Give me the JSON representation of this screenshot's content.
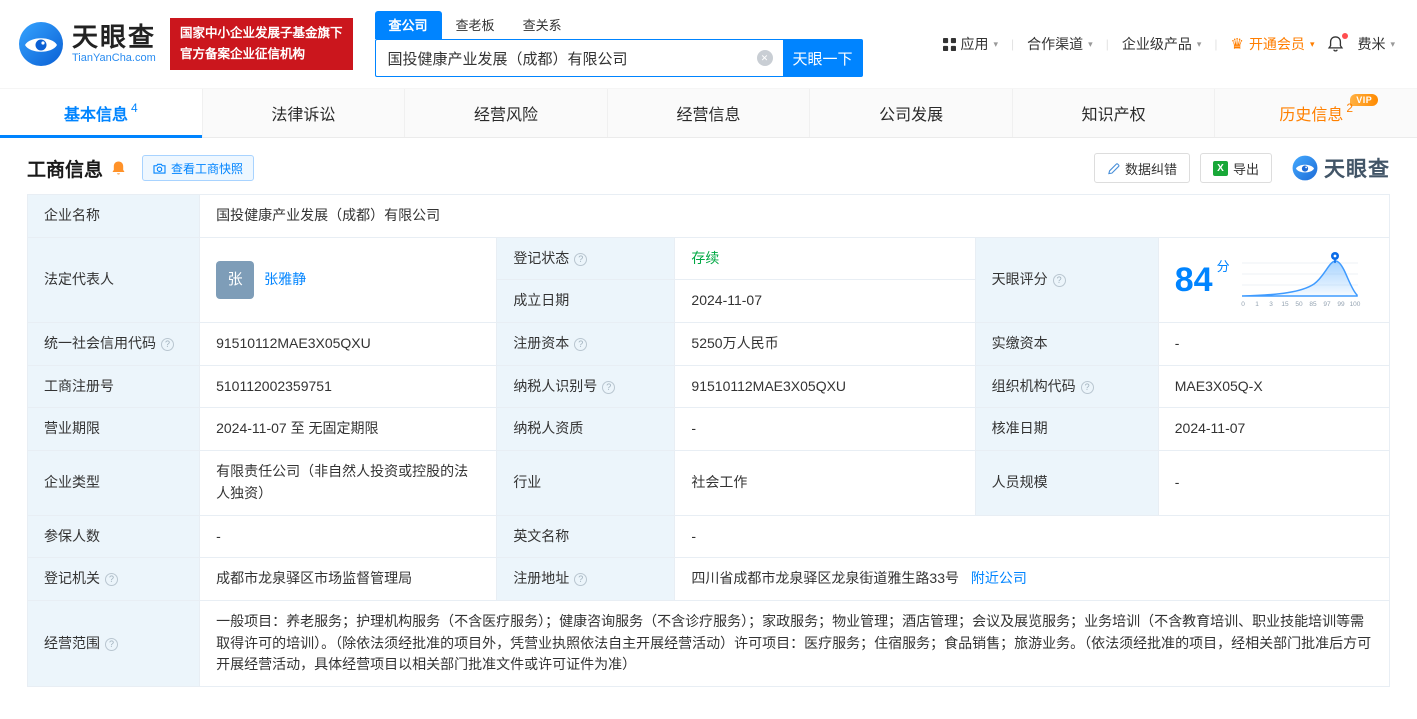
{
  "colors": {
    "brand_blue": "#0084ff",
    "badge_red": "#cb161d",
    "member_orange": "#ff7e00",
    "history_orange": "#ff8000",
    "status_green": "#00a843",
    "label_cell_bg": "#ecf5fb"
  },
  "header": {
    "logo_text": "天眼查",
    "logo_sub": "TianYanCha.com",
    "badge_line1": "国家中小企业发展子基金旗下",
    "badge_line2": "官方备案企业征信机构",
    "search_tabs": [
      {
        "label": "查公司"
      },
      {
        "label": "查老板"
      },
      {
        "label": "查关系"
      }
    ],
    "search_value": "国投健康产业发展（成都）有限公司",
    "search_button": "天眼一下",
    "nav": {
      "apps": "应用",
      "partner": "合作渠道",
      "enterprise": "企业级产品",
      "member": "开通会员",
      "user": "费米"
    }
  },
  "tabs": [
    {
      "label": "基本信息",
      "count": "4"
    },
    {
      "label": "法律诉讼"
    },
    {
      "label": "经营风险"
    },
    {
      "label": "经营信息"
    },
    {
      "label": "公司发展"
    },
    {
      "label": "知识产权"
    },
    {
      "label": "历史信息",
      "count": "2",
      "badge": "VIP"
    }
  ],
  "section": {
    "title": "工商信息",
    "snapshot_button": "查看工商快照",
    "correction_button": "数据纠错",
    "export_button": "导出",
    "watermark": "天眼查"
  },
  "biz": {
    "company_name_label": "企业名称",
    "company_name": "国投健康产业发展（成都）有限公司",
    "legal_rep_label": "法定代表人",
    "avatar_char": "张",
    "legal_rep": "张雅静",
    "status_label": "登记状态",
    "status": "存续",
    "score_label": "天眼评分",
    "score_value": "84",
    "score_unit": "分",
    "score_ticks": [
      "0",
      "1",
      "3",
      "15",
      "50",
      "85",
      "97",
      "99",
      "100"
    ],
    "established_label": "成立日期",
    "established": "2024-11-07",
    "credit_code_label": "统一社会信用代码",
    "credit_code": "91510112MAE3X05QXU",
    "reg_capital_label": "注册资本",
    "reg_capital": "5250万人民币",
    "paid_capital_label": "实缴资本",
    "paid_capital": "-",
    "reg_number_label": "工商注册号",
    "reg_number": "510112002359751",
    "taxpayer_id_label": "纳税人识别号",
    "taxpayer_id": "91510112MAE3X05QXU",
    "org_code_label": "组织机构代码",
    "org_code": "MAE3X05Q-X",
    "term_label": "营业期限",
    "term": "2024-11-07 至 无固定期限",
    "taxpayer_quality_label": "纳税人资质",
    "taxpayer_quality": "-",
    "approval_date_label": "核准日期",
    "approval_date": "2024-11-07",
    "company_type_label": "企业类型",
    "company_type": "有限责任公司（非自然人投资或控股的法人独资）",
    "industry_label": "行业",
    "industry": "社会工作",
    "staff_size_label": "人员规模",
    "staff_size": "-",
    "insured_label": "参保人数",
    "insured": "-",
    "english_name_label": "英文名称",
    "english_name": "-",
    "registry_label": "登记机关",
    "registry": "成都市龙泉驿区市场监督管理局",
    "address_label": "注册地址",
    "address": "四川省成都市龙泉驿区龙泉街道雅生路33号",
    "nearby_link": "附近公司",
    "scope_label": "经营范围",
    "scope": "一般项目：养老服务；护理机构服务（不含医疗服务）；健康咨询服务（不含诊疗服务）；家政服务；物业管理；酒店管理；会议及展览服务；业务培训（不含教育培训、职业技能培训等需取得许可的培训）。（除依法须经批准的项目外，凭营业执照依法自主开展经营活动）许可项目：医疗服务；住宿服务；食品销售；旅游业务。（依法须经批准的项目，经相关部门批准后方可开展经营活动，具体经营项目以相关部门批准文件或许可证件为准）"
  }
}
